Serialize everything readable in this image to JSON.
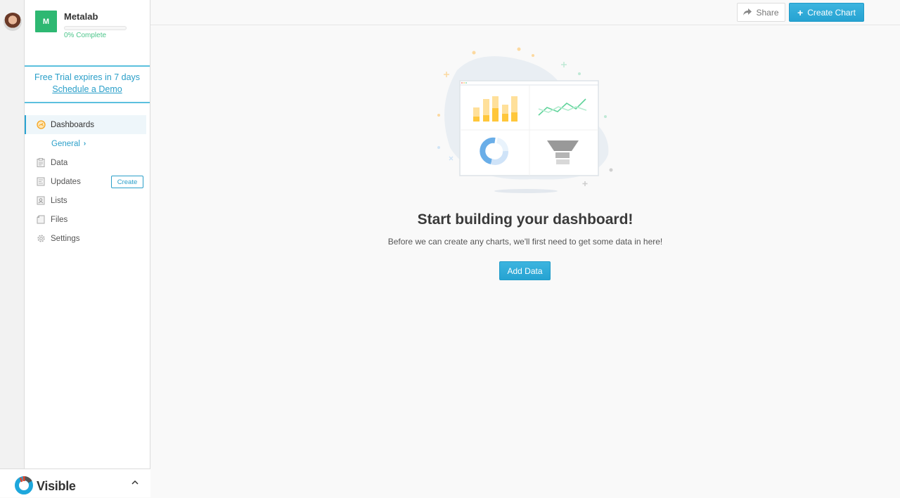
{
  "user": {
    "avatar_alt": "User avatar"
  },
  "organization": {
    "initial": "M",
    "name": "Metalab",
    "progress_fraction": 0,
    "progress_label": "0% Complete",
    "logo_color": "#2eb872"
  },
  "trial": {
    "message": "Free Trial expires in 7 days",
    "link_label": "Schedule a Demo"
  },
  "sidebar": {
    "items": [
      {
        "label": "Dashboards",
        "icon": "dashboard-gauge-icon",
        "active": true
      },
      {
        "label": "Data",
        "icon": "clipboard-icon"
      },
      {
        "label": "Updates",
        "icon": "updates-icon",
        "action_label": "Create"
      },
      {
        "label": "Lists",
        "icon": "contact-list-icon"
      },
      {
        "label": "Files",
        "icon": "file-icon"
      },
      {
        "label": "Settings",
        "icon": "gear-icon"
      }
    ],
    "sub_item": {
      "label": "General",
      "icon": "chevron-right-icon"
    }
  },
  "footer": {
    "brand_name": "Visible",
    "collapse_icon": "chevron-up-icon"
  },
  "toolbar": {
    "share_label": "Share",
    "create_chart_label": "Create Chart"
  },
  "empty_state": {
    "title": "Start building your dashboard!",
    "message": "Before we can create any charts, we'll first need to get some data in here!",
    "button_label": "Add Data"
  },
  "colors": {
    "accent": "#29a3d1",
    "success": "#2eb872"
  }
}
